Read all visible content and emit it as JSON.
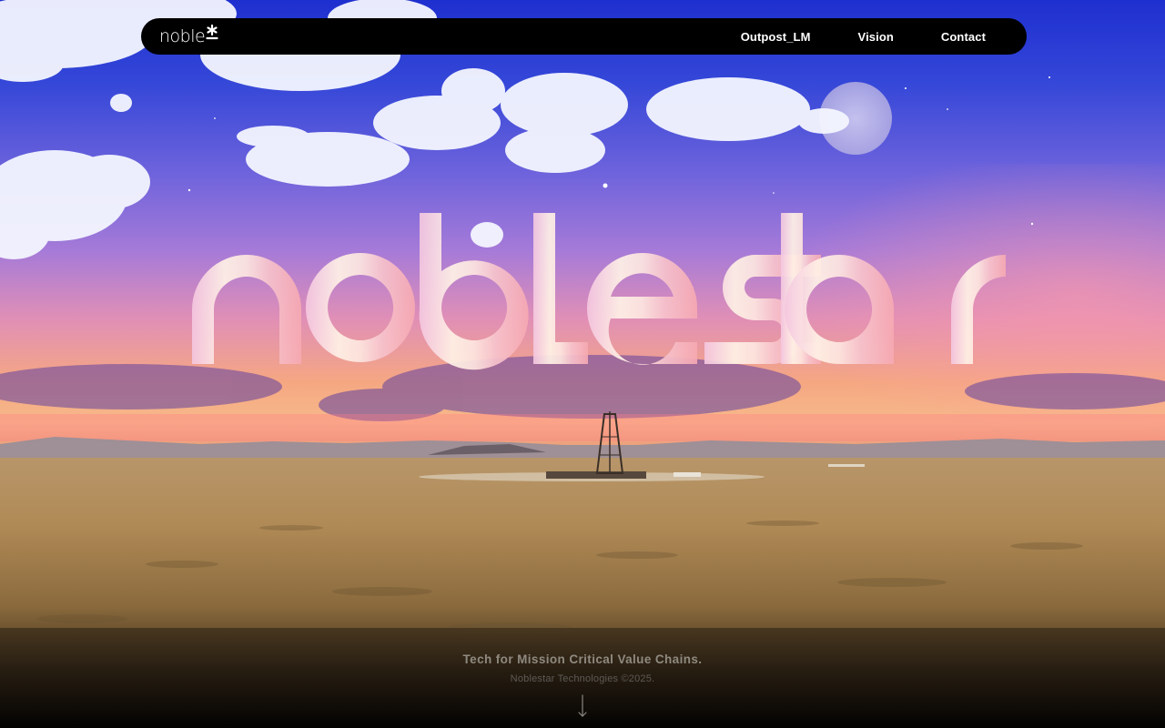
{
  "header": {
    "logo_text": "noble",
    "logo_icon": "asterisk-star-icon",
    "nav": [
      {
        "label": "Outpost_LM"
      },
      {
        "label": "Vision"
      },
      {
        "label": "Contact"
      }
    ]
  },
  "hero": {
    "wordmark": "noblestar",
    "background_description_icon": "desert-oil-rig-sunset-scene"
  },
  "footer": {
    "tagline": "Tech for Mission Critical Value Chains.",
    "copyright": "Noblestar Technologies ©2025.",
    "scroll_icon": "arrow-down-icon"
  },
  "colors": {
    "nav_bg": "#000000",
    "nav_text": "#ffffff",
    "sky_top": "#1a2fd0",
    "sky_mid": "#6a5ad8",
    "horizon": "#f3a07a",
    "sand": "#b58c52",
    "wordmark_pink": "#f6c6dc"
  }
}
